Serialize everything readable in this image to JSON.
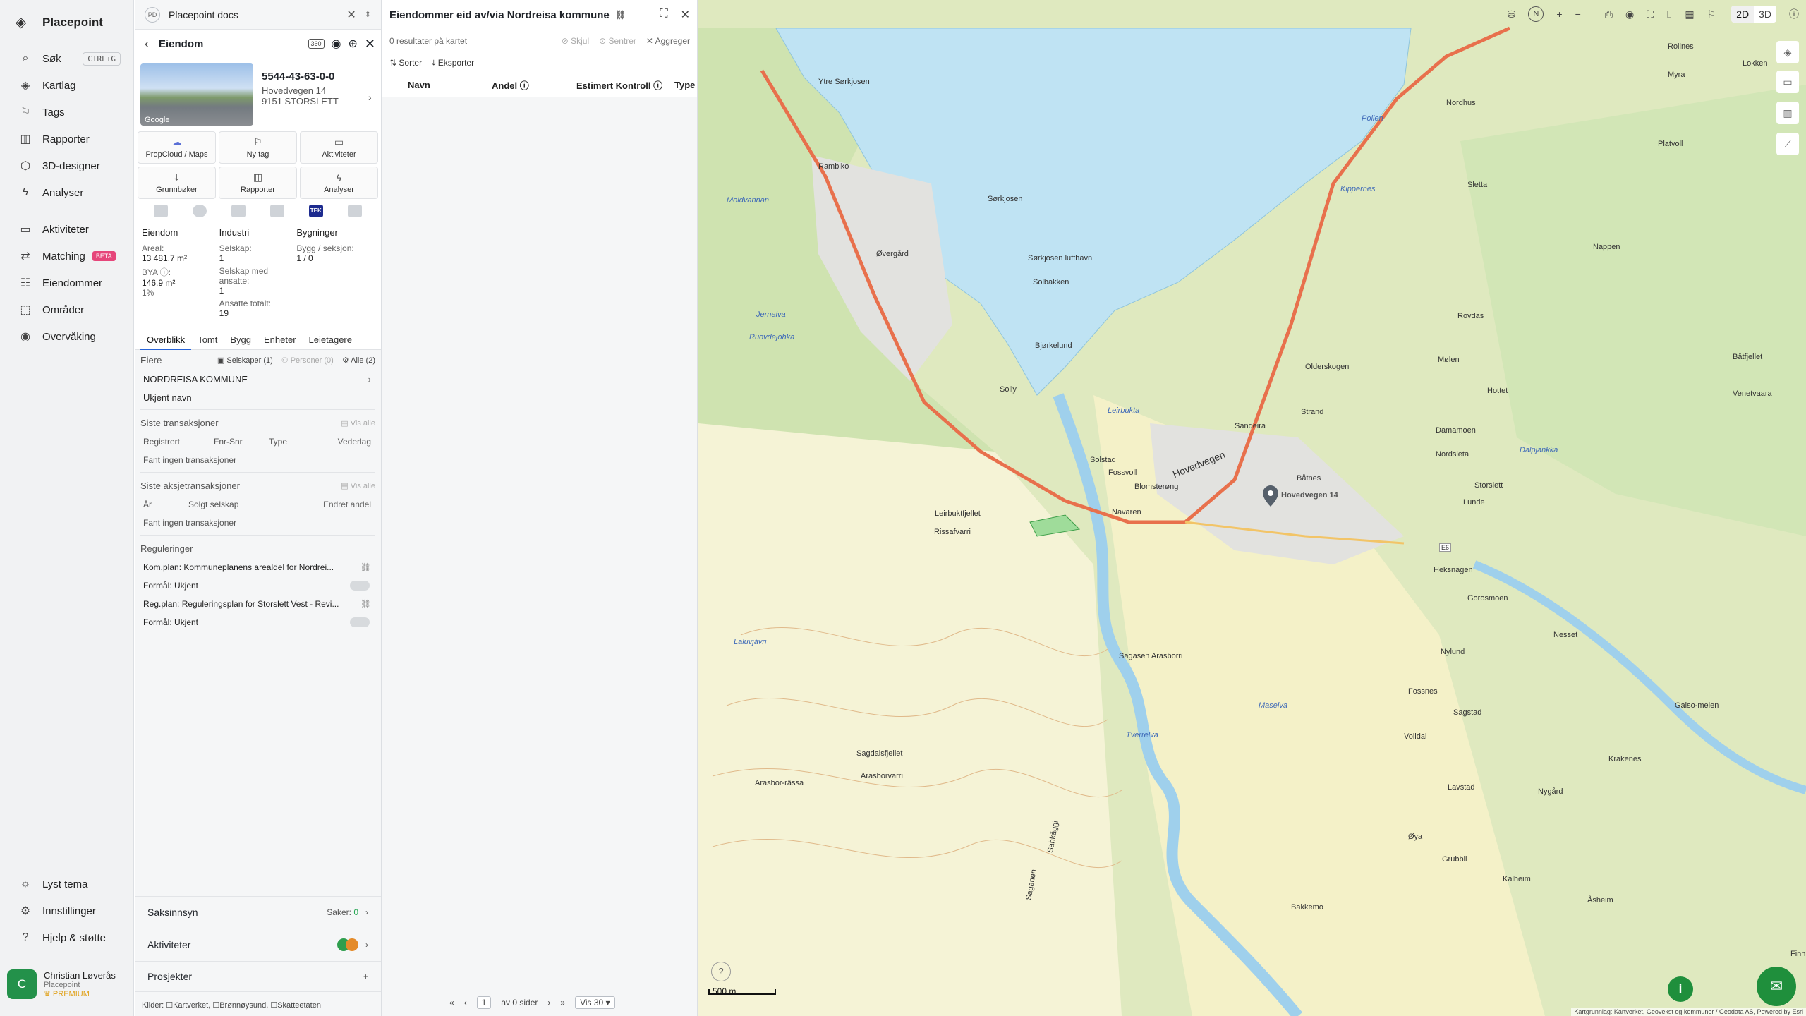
{
  "nav": {
    "brand": "Placepoint",
    "items": [
      {
        "label": "Søk",
        "kbd": "CTRL+G",
        "icon": "search-icon"
      },
      {
        "label": "Kartlag",
        "icon": "layers-icon"
      },
      {
        "label": "Tags",
        "icon": "bookmark-icon"
      },
      {
        "label": "Rapporter",
        "icon": "chart-icon"
      },
      {
        "label": "3D-designer",
        "icon": "cube-icon"
      },
      {
        "label": "Analyser",
        "icon": "bolt-icon"
      }
    ],
    "items2": [
      {
        "label": "Aktiviteter",
        "icon": "chat-icon"
      },
      {
        "label": "Matching",
        "badge": "BETA",
        "icon": "swap-icon"
      },
      {
        "label": "Eiendommer",
        "icon": "list-icon"
      },
      {
        "label": "Områder",
        "icon": "area-icon"
      },
      {
        "label": "Overvåking",
        "icon": "eye-icon"
      }
    ],
    "bottom": [
      {
        "label": "Lyst tema",
        "icon": "sun-icon"
      },
      {
        "label": "Innstillinger",
        "icon": "gear-icon"
      },
      {
        "label": "Hjelp & støtte",
        "icon": "help-icon"
      }
    ],
    "user": {
      "initial": "C",
      "name": "Christian Løverås",
      "org": "Placepoint",
      "plan": "PREMIUM"
    }
  },
  "docs": {
    "initials": "PD",
    "title": "Placepoint docs"
  },
  "eiendom": {
    "header": "Eiendom",
    "badge360": "360",
    "photo_label": "Google",
    "id": "5544-43-63-0-0",
    "address1": "Hovedvegen 14",
    "address2": "9151 STORSLETT",
    "tiles": [
      {
        "label": "PropCloud / Maps",
        "icon": "cloud-icon"
      },
      {
        "label": "Ny tag",
        "icon": "bookmark-icon"
      },
      {
        "label": "Aktiviteter",
        "icon": "chat-icon"
      },
      {
        "label": "Grunnbøker",
        "icon": "download-icon"
      },
      {
        "label": "Rapporter",
        "icon": "chart-icon"
      },
      {
        "label": "Analyser",
        "icon": "bolt-icon"
      }
    ],
    "tek": "TEK",
    "stats": {
      "c1": {
        "h": "Eiendom",
        "l1": "Areal:",
        "v1": "13 481.7 m²",
        "l2": "BYA ⓘ:",
        "v2": "146.9 m²",
        "v3": "1%"
      },
      "c2": {
        "h": "Industri",
        "l1": "Selskap:",
        "v1": "1",
        "l2": "Selskap med ansatte:",
        "v2": "1",
        "l3": "Ansatte totalt:",
        "v3": "19"
      },
      "c3": {
        "h": "Bygninger",
        "l1": "Bygg / seksjon:",
        "v1": "1 / 0"
      }
    },
    "tabs": [
      "Overblikk",
      "Tomt",
      "Bygg",
      "Enheter",
      "Leietagere"
    ],
    "eiere": {
      "h": "Eiere",
      "f1": "Selskaper (1)",
      "f2": "Personer (0)",
      "f3": "Alle (2)",
      "owner": "NORDREISA KOMMUNE",
      "unknown": "Ukjent navn"
    },
    "trans": {
      "h": "Siste transaksjoner",
      "vis": "Vis alle",
      "c1": "Registrert",
      "c2": "Fnr-Snr",
      "c3": "Type",
      "c4": "Vederlag",
      "empty": "Fant ingen transaksjoner"
    },
    "aksje": {
      "h": "Siste aksjetransaksjoner",
      "vis": "Vis alle",
      "c1": "År",
      "c2": "Solgt selskap",
      "c3": "Endret andel",
      "empty": "Fant ingen transaksjoner"
    },
    "reg": {
      "h": "Reguleringer",
      "r1": "Kom.plan: Kommuneplanens arealdel for Nordrei...",
      "f1": "Formål: Ukjent",
      "r2": "Reg.plan: Reguleringsplan for Storslett Vest - Revi...",
      "f2": "Formål: Ukjent"
    },
    "saksinnsyn": {
      "label": "Saksinnsyn",
      "saker_label": "Saker:",
      "saker": "0"
    },
    "aktiviteter": "Aktiviteter",
    "prosjekter": "Prosjekter",
    "kilder": "Kilder: ☐Kartverket, ☐Brønnøysund, ☐Skatteetaten"
  },
  "list": {
    "title": "Eiendommer eid av/via Nordreisa kommune",
    "count": "0 resultater på kartet",
    "skjul": "Skjul",
    "sentrer": "Sentrer",
    "aggreger": "Aggreger",
    "sorter": "Sorter",
    "eksporter": "Eksporter",
    "cols": [
      "Navn",
      "Andel ⓘ",
      "Estimert Kontroll ⓘ",
      "Type"
    ],
    "page": "1",
    "of": "av 0 sider",
    "vis": "Vis 30"
  },
  "map": {
    "modes": [
      "2D",
      "3D"
    ],
    "scale": "500 m",
    "copyright": "Kartgrunnlag: Kartverket, Geovekst og kommuner / Geodata AS, Powered by Esri",
    "pin_label": "Hovedvegen 14",
    "labels": [
      {
        "t": "Ytre Sørkjosen",
        "w": false
      },
      {
        "t": "Rambiko",
        "w": false
      },
      {
        "t": "Sørkjosen",
        "w": false
      },
      {
        "t": "Sørkjosen lufthavn",
        "w": false
      },
      {
        "t": "Solbakken",
        "w": false
      },
      {
        "t": "Øvergård",
        "w": false
      },
      {
        "t": "Moldvannan",
        "w": true
      },
      {
        "t": "Jernelva",
        "w": true
      },
      {
        "t": "Ruovdejohka",
        "w": true
      },
      {
        "t": "Bjørkelund",
        "w": false
      },
      {
        "t": "Solly",
        "w": false
      },
      {
        "t": "Leirbukta",
        "w": true
      },
      {
        "t": "Sandeira",
        "w": false
      },
      {
        "t": "Solstad",
        "w": false
      },
      {
        "t": "Fossvoll",
        "w": false
      },
      {
        "t": "Blomsterøng",
        "w": false
      },
      {
        "t": "Navaren",
        "w": false
      },
      {
        "t": "Båtnes",
        "w": false
      },
      {
        "t": "Storslett",
        "w": false
      },
      {
        "t": "Leirbuktfjellet",
        "w": false
      },
      {
        "t": "Rissafvarri",
        "w": false
      },
      {
        "t": "Sagasen Arasborri",
        "w": false
      },
      {
        "t": "Sagdalsfjellet",
        "w": false
      },
      {
        "t": "Arasborvarri",
        "w": false
      },
      {
        "t": "Arasbor-rässa",
        "w": false
      },
      {
        "t": "Tverrelva",
        "w": true
      },
      {
        "t": "Maselva",
        "w": true
      },
      {
        "t": "Laluvjávri",
        "w": true
      },
      {
        "t": "Pollen",
        "w": true
      },
      {
        "t": "Kippernes",
        "w": false
      },
      {
        "t": "Sletta",
        "w": false
      },
      {
        "t": "Nappen",
        "w": false
      },
      {
        "t": "Rovdas",
        "w": false
      },
      {
        "t": "Mølen",
        "w": false
      },
      {
        "t": "Olderskogen",
        "w": false
      },
      {
        "t": "Hottet",
        "w": false
      },
      {
        "t": "Strand",
        "w": false
      },
      {
        "t": "Damamoen",
        "w": false
      },
      {
        "t": "Nordsleta",
        "w": false
      },
      {
        "t": "Lunde",
        "w": false
      },
      {
        "t": "Heksnagen",
        "w": false
      },
      {
        "t": "Gorosmoen",
        "w": false
      },
      {
        "t": "Nylund",
        "w": false
      },
      {
        "t": "Nesset",
        "w": false
      },
      {
        "t": "Fossnes",
        "w": false
      },
      {
        "t": "Sagstad",
        "w": false
      },
      {
        "t": "Volldal",
        "w": false
      },
      {
        "t": "Lavstad",
        "w": false
      },
      {
        "t": "Nygård",
        "w": false
      },
      {
        "t": "Krakenes",
        "w": false
      },
      {
        "t": "Øya",
        "w": false
      },
      {
        "t": "Grubbli",
        "w": false
      },
      {
        "t": "Kalheim",
        "w": false
      },
      {
        "t": "Bakkemo",
        "w": false
      },
      {
        "t": "Åsheim",
        "w": false
      },
      {
        "t": "Båtfjellet",
        "w": false
      },
      {
        "t": "Venetvaara",
        "w": false
      },
      {
        "t": "Rollnes",
        "w": false
      },
      {
        "t": "Lokken",
        "w": false
      },
      {
        "t": "Myra",
        "w": false
      },
      {
        "t": "Platvoll",
        "w": false
      },
      {
        "t": "Nordhus",
        "w": false
      },
      {
        "t": "Hovedvegen",
        "w": false
      },
      {
        "t": "Finnbakken",
        "w": false
      },
      {
        "t": "Gaiso-melen",
        "w": false
      },
      {
        "t": "Saganen",
        "w": false
      },
      {
        "t": "Sahkåggi",
        "w": false
      },
      {
        "t": "Dalpjankka",
        "w": true
      },
      {
        "t": "E6",
        "w": false
      }
    ]
  }
}
